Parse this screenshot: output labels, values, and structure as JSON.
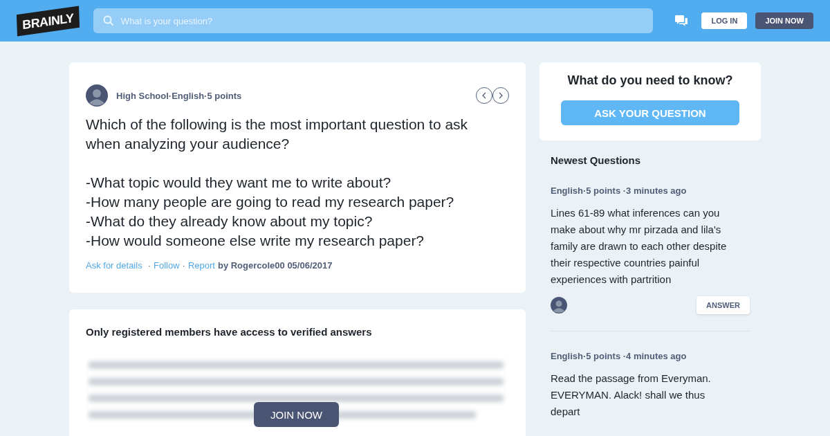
{
  "header": {
    "logo": "BRAINLY",
    "search": {
      "placeholder": "What is your question?"
    },
    "login": "LOG IN",
    "join": "JOIN NOW"
  },
  "question": {
    "meta": [
      "High School",
      "English",
      "5 points"
    ],
    "separator": "·",
    "text": "Which of the following is the most important question to ask when analyzing your audience?",
    "options": [
      "-What topic would they want me to write about?",
      "-How many people are going to read my research paper?",
      "-What do they already know about my topic?",
      "-How would someone else write my research paper?"
    ],
    "actions": [
      "Ask for details",
      "Follow",
      "Report"
    ],
    "author": "by Rogercole00 05/06/2017"
  },
  "answers": {
    "notice": "Only registered members have access to verified answers",
    "join": "JOIN NOW"
  },
  "ask": {
    "title": "What do you need to know?",
    "button": "ASK YOUR QUESTION"
  },
  "newest": {
    "title": "Newest Questions",
    "items": [
      {
        "meta": "English·5 points ·3 minutes ago",
        "text": "Lines 61-89 what inferences can you make about why mr pirzada and lila's family are drawn to each other despite their respective countries painful experiences with partrition",
        "answer": "ANSWER"
      },
      {
        "meta": "English·5 points ·4 minutes ago",
        "text": "Read the passage from Everyman. EVERYMAN. Alack! shall we thus depart"
      }
    ]
  }
}
